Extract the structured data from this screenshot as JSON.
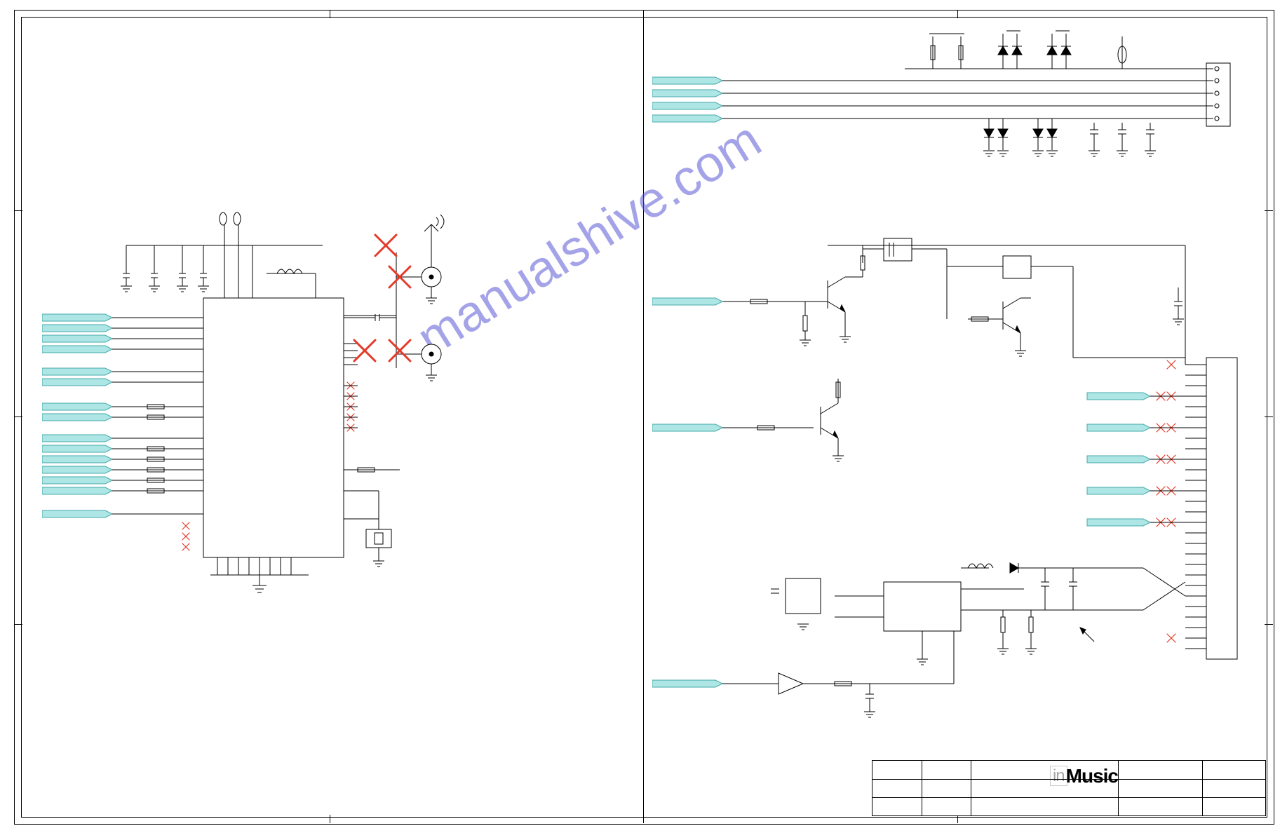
{
  "document": {
    "watermark": "manualshive.com",
    "brand_logo_prefix": "in",
    "brand_logo_main": "Music"
  },
  "title_block": {
    "title": "",
    "doc_number": "",
    "rev": "",
    "sheet": "",
    "date": ""
  },
  "left_sheet": {
    "ic_block": {
      "ref": "",
      "part": ""
    },
    "bus_ports_left": [
      "",
      "",
      "",
      "",
      "",
      "",
      "",
      "",
      "",
      "",
      "",
      "",
      "",
      "",
      "",
      ""
    ],
    "antenna": {
      "label": ""
    },
    "dnp_markers": [
      "X",
      "X",
      "X",
      "X",
      "X"
    ]
  },
  "right_sheet": {
    "top_bus_ports": [
      "",
      "",
      "",
      ""
    ],
    "mid_bus_ports": [
      "",
      ""
    ],
    "connector_right": {
      "ref": "",
      "pins": 30
    },
    "right_small_bus_ports": [
      "",
      "",
      "",
      "",
      ""
    ],
    "regulator_block": {
      "ref": "",
      "part": ""
    },
    "bottom_bus_port": ""
  },
  "chart_data": {
    "type": "schematic",
    "note": "Electronic schematic diagram (two sheets). Contains an integrated-circuit block with surrounding passive components, antenna circuitry with red 'do-not-populate' X markers, bus/net port arrows (cyan), discrete transistor / MOSFET driver stages on the right sheet, a multi-pin board-edge connector, a switching-regulator sub-circuit, and a title block with the inMusic logo. No numeric component values or net names are legible in the image."
  }
}
